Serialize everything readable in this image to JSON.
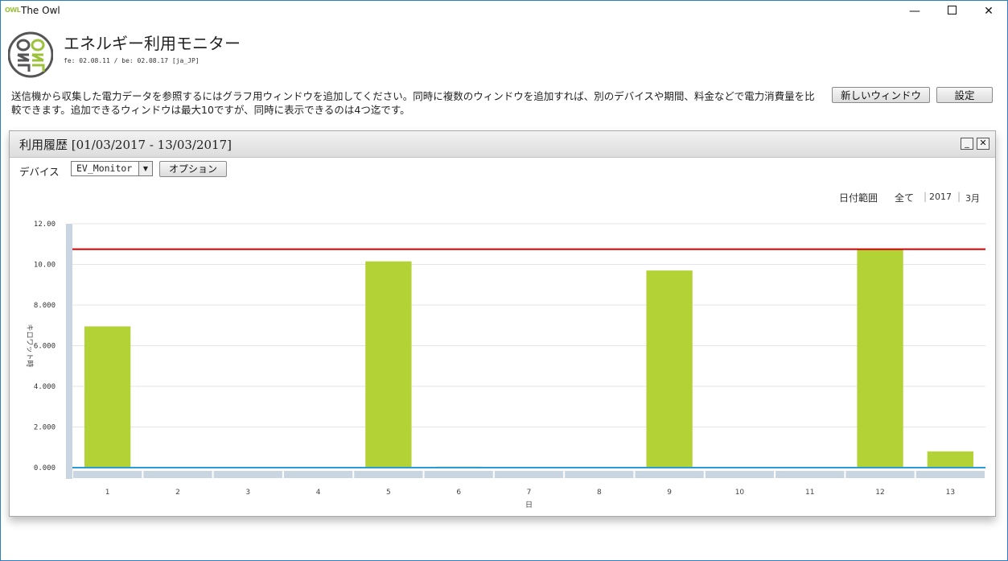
{
  "window": {
    "app_icon_text": "OWL",
    "title": "The Owl",
    "min_glyph": "—",
    "close_glyph": "✕"
  },
  "header": {
    "heading": "エネルギー利用モニター",
    "version": "fe: 02.08.11 / be: 02.08.17 [ja_JP]",
    "description": "送信機から収集した電力データを参照するにはグラフ用ウィンドウを追加してください。同時に複数のウィンドウを追加すれば、別のデバイスや期間、料金などで電力消費量を比較できます。追加できるウィンドウは最大10ですが、同時に表示できるのは4つ迄です。",
    "new_window_label": "新しいウィンドウ",
    "settings_label": "設定"
  },
  "panel": {
    "title": "利用履歴 [01/03/2017 - 13/03/2017]",
    "minimize_glyph": "_",
    "close_glyph": "✕",
    "device_label": "デバイス",
    "device_value": "EV_Monitor",
    "options_label": "オプション",
    "date_range_label": "日付範囲",
    "range_all": "全て",
    "range_year": "2017",
    "range_month": "3月",
    "separator": "|"
  },
  "chart_data": {
    "type": "bar",
    "categories": [
      "1",
      "2",
      "3",
      "4",
      "5",
      "6",
      "7",
      "8",
      "9",
      "10",
      "11",
      "12",
      "13"
    ],
    "values": [
      6.95,
      0,
      0,
      0,
      10.15,
      0.05,
      0,
      0,
      9.7,
      0,
      0,
      10.75,
      0.8
    ],
    "ylabel": "キロワット時",
    "xlabel": "日",
    "ylim": [
      0,
      12
    ],
    "yticks": [
      "0.000",
      "2.000",
      "4.000",
      "6.000",
      "8.000",
      "10.00",
      "12.00"
    ],
    "reference_line": 10.75,
    "bar_color": "#b3d236",
    "reference_color": "#d00000",
    "baseline_color": "#2a9ad8",
    "grid": true
  }
}
